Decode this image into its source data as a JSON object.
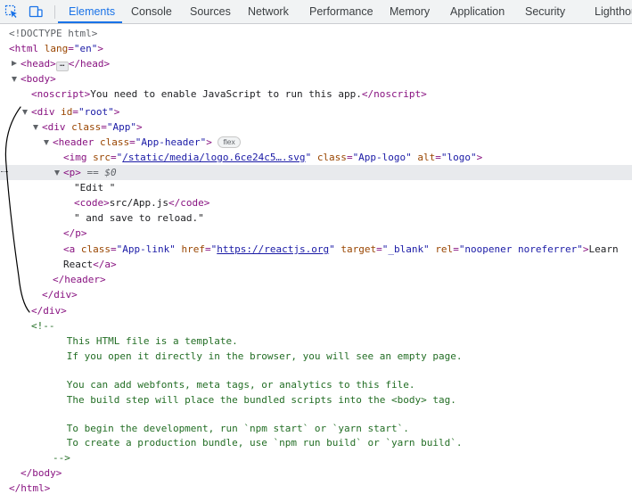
{
  "toolbar": {
    "inspect_icon": "inspect-element-icon",
    "device_icon": "device-toolbar-icon"
  },
  "tabs": [
    {
      "label": "Elements",
      "active": true
    },
    {
      "label": "Console"
    },
    {
      "label": "Sources"
    },
    {
      "label": "Network"
    },
    {
      "label": "Performance"
    },
    {
      "label": "Memory"
    },
    {
      "label": "Application"
    },
    {
      "label": "Security"
    },
    {
      "label": "Lighthouse"
    }
  ],
  "colors": {
    "accent": "#1a73e8",
    "tag": "#881280",
    "attr_name": "#994500",
    "attr_value": "#1a1aa6",
    "comment": "#236e25"
  },
  "tree": {
    "doctype": "<!DOCTYPE html>",
    "html_open": "<html",
    "html_lang_attr": "lang",
    "html_lang_val": "\"en\"",
    "head_open": "<head>",
    "head_close": "</head>",
    "head_ellipsis": "…",
    "body_open": "<body>",
    "noscript_open": "<noscript>",
    "noscript_text": "You need to enable JavaScript to run this app.",
    "noscript_close": "</noscript>",
    "div_root_open": "<div",
    "id_attr": "id",
    "root_val": "\"root\"",
    "div_app_open": "<div",
    "class_attr": "class",
    "app_val": "\"App\"",
    "header_open": "<header",
    "app_header_val": "\"App-header\"",
    "flex_badge": "flex",
    "img_open": "<img",
    "src_attr": "src",
    "img_src": "/static/media/logo.6ce24c5….svg",
    "app_logo_val": "\"App-logo\"",
    "alt_attr": "alt",
    "alt_val": "\"logo\"",
    "p_open": "<p>",
    "selected_marker": "== $0",
    "text_edit": "\"Edit \"",
    "code_open": "<code>",
    "code_text": "src/App.js",
    "code_close": "</code>",
    "text_save": "\" and save to reload.\"",
    "p_close": "</p>",
    "a_open": "<a",
    "app_link_val": "\"App-link\"",
    "href_attr": "href",
    "href_val": "https://reactjs.org",
    "target_attr": "target",
    "target_val": "\"_blank\"",
    "rel_attr": "rel",
    "rel_val": "\"noopener noreferrer\"",
    "a_text_1": "Learn",
    "a_text_2": "React",
    "a_close": "</a>",
    "header_close": "</header>",
    "div_close": "</div>",
    "comment_open": "<!--",
    "comment_lines": [
      "      This HTML file is a template.",
      "      If you open it directly in the browser, you will see an empty page.",
      "",
      "      You can add webfonts, meta tags, or analytics to this file.",
      "      The build step will place the bundled scripts into the <body> tag.",
      "",
      "      To begin the development, run `npm start` or `yarn start`.",
      "      To create a production bundle, use `npm run build` or `yarn build`."
    ],
    "comment_close": "-->",
    "body_close": "</body>",
    "html_close": "</html>"
  }
}
